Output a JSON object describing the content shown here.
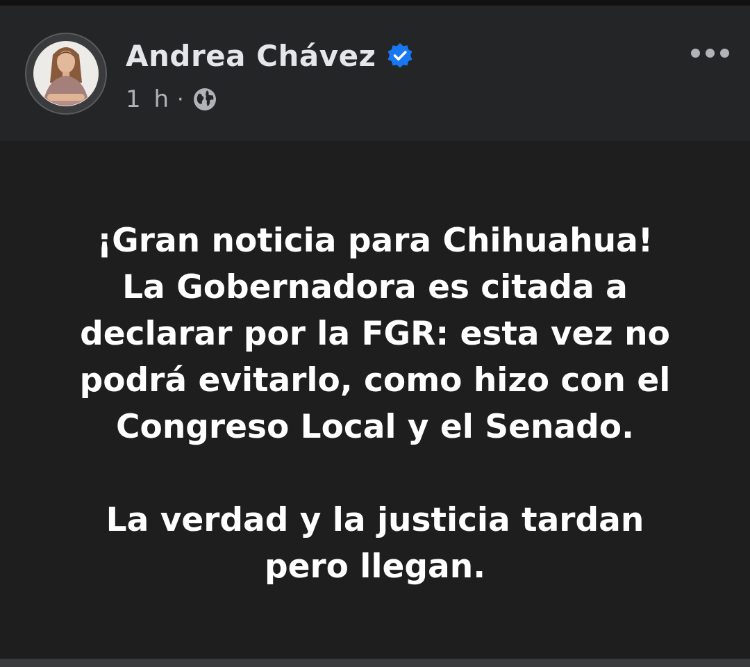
{
  "post": {
    "author": "Andrea Chávez",
    "time": "1 h",
    "separator": "·",
    "icons": {
      "verified": "verified-badge-icon",
      "privacy": "globe-icon",
      "more": "more-options-icon"
    },
    "colors": {
      "verified": "#1877f2",
      "text": "#ffffff",
      "meta": "#b0b3b8"
    },
    "body": {
      "paragraph1": {
        "line1": "¡Gran noticia para Chihuahua!",
        "line2": "La Gobernadora es citada a",
        "line3": "declarar por la FGR: esta vez no",
        "line4": "podrá evitarlo, como hizo con el",
        "line5": "Congreso Local y el Senado."
      },
      "paragraph2": {
        "line1": "La verdad y la justicia tardan",
        "line2": "pero llegan."
      }
    }
  }
}
